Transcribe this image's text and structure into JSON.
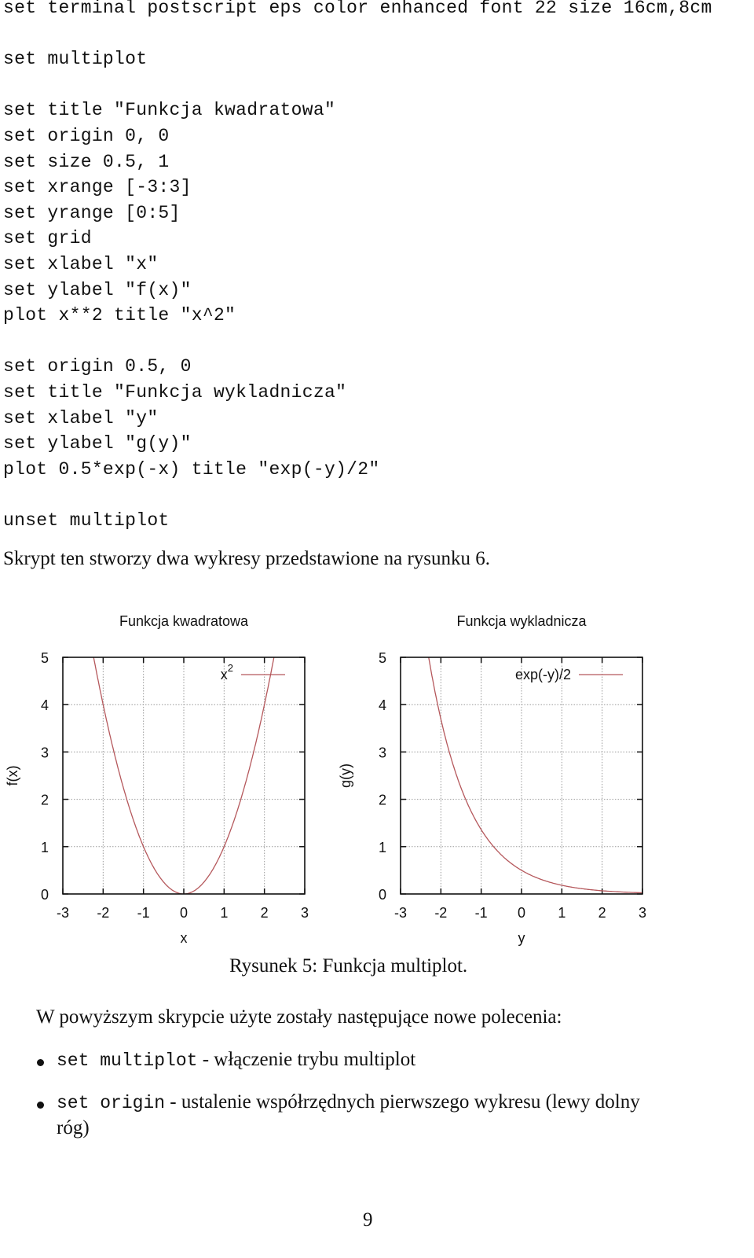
{
  "code_block": {
    "lines": [
      "set terminal postscript eps color enhanced font 22 size 16cm,8cm",
      "",
      "set multiplot",
      "",
      "set title \"Funkcja kwadratowa\"",
      "set origin 0, 0",
      "set size 0.5, 1",
      "set xrange [-3:3]",
      "set yrange [0:5]",
      "set grid",
      "set xlabel \"x\"",
      "set ylabel \"f(x)\"",
      "plot x**2 title \"x^2\"",
      "",
      "set origin 0.5, 0",
      "set title \"Funkcja wykladnicza\"",
      "set xlabel \"y\"",
      "set ylabel \"g(y)\"",
      "plot 0.5*exp(-x) title \"exp(-y)/2\"",
      "",
      "unset multiplot"
    ]
  },
  "intro_text": "Skrypt ten stworzy dwa wykresy przedstawione na rysunku 6.",
  "figure_caption": "Rysunek 5: Funkcja multiplot.",
  "list_intro": "W powyższym skrypcie użyte zostały następujące nowe polecenia:",
  "list_items": [
    {
      "command": "set multiplot",
      "description": " - włączenie trybu multiplot"
    },
    {
      "command": "set origin",
      "description": " - ustalenie współrzędnych pierwszego wykresu (lewy dolny",
      "continuation": "róg)"
    }
  ],
  "page_number": "9",
  "colors": {
    "curve": "#b5585c",
    "grid": "#9a9a9a",
    "axis": "#111111"
  },
  "chart_data": [
    {
      "type": "line",
      "title": "Funkcja kwadratowa",
      "xlabel": "x",
      "ylabel": "f(x)",
      "xlim": [
        -3,
        3
      ],
      "ylim": [
        0,
        5
      ],
      "grid": true,
      "x_ticks": [
        "-3",
        "-2",
        "-1",
        "0",
        "1",
        "2",
        "3"
      ],
      "y_ticks": [
        "0",
        "1",
        "2",
        "3",
        "4",
        "5"
      ],
      "legend": {
        "position": "top-right",
        "entries": [
          {
            "label": "x",
            "superscript": "2"
          }
        ]
      },
      "series": [
        {
          "name": "x^2",
          "function": "x**2",
          "x": [
            -2.24,
            -2,
            -1.5,
            -1,
            -0.5,
            0,
            0.5,
            1,
            1.5,
            2,
            2.24
          ],
          "y": [
            5.0,
            4.0,
            2.25,
            1.0,
            0.25,
            0.0,
            0.25,
            1.0,
            2.25,
            4.0,
            5.0
          ]
        }
      ]
    },
    {
      "type": "line",
      "title": "Funkcja wykladnicza",
      "xlabel": "y",
      "ylabel": "g(y)",
      "xlim": [
        -3,
        3
      ],
      "ylim": [
        0,
        5
      ],
      "grid": true,
      "x_ticks": [
        "-3",
        "-2",
        "-1",
        "0",
        "1",
        "2",
        "3"
      ],
      "y_ticks": [
        "0",
        "1",
        "2",
        "3",
        "4",
        "5"
      ],
      "legend": {
        "position": "top-right",
        "entries": [
          {
            "label": "exp(-y)/2",
            "superscript": ""
          }
        ]
      },
      "series": [
        {
          "name": "exp(-y)/2",
          "function": "0.5*exp(-x)",
          "x": [
            -2.3,
            -2,
            -1.5,
            -1,
            -0.5,
            0,
            0.5,
            1,
            1.5,
            2,
            2.5,
            3
          ],
          "y": [
            4.99,
            3.69,
            2.24,
            1.36,
            0.82,
            0.5,
            0.3,
            0.18,
            0.11,
            0.07,
            0.04,
            0.02
          ]
        }
      ]
    }
  ]
}
